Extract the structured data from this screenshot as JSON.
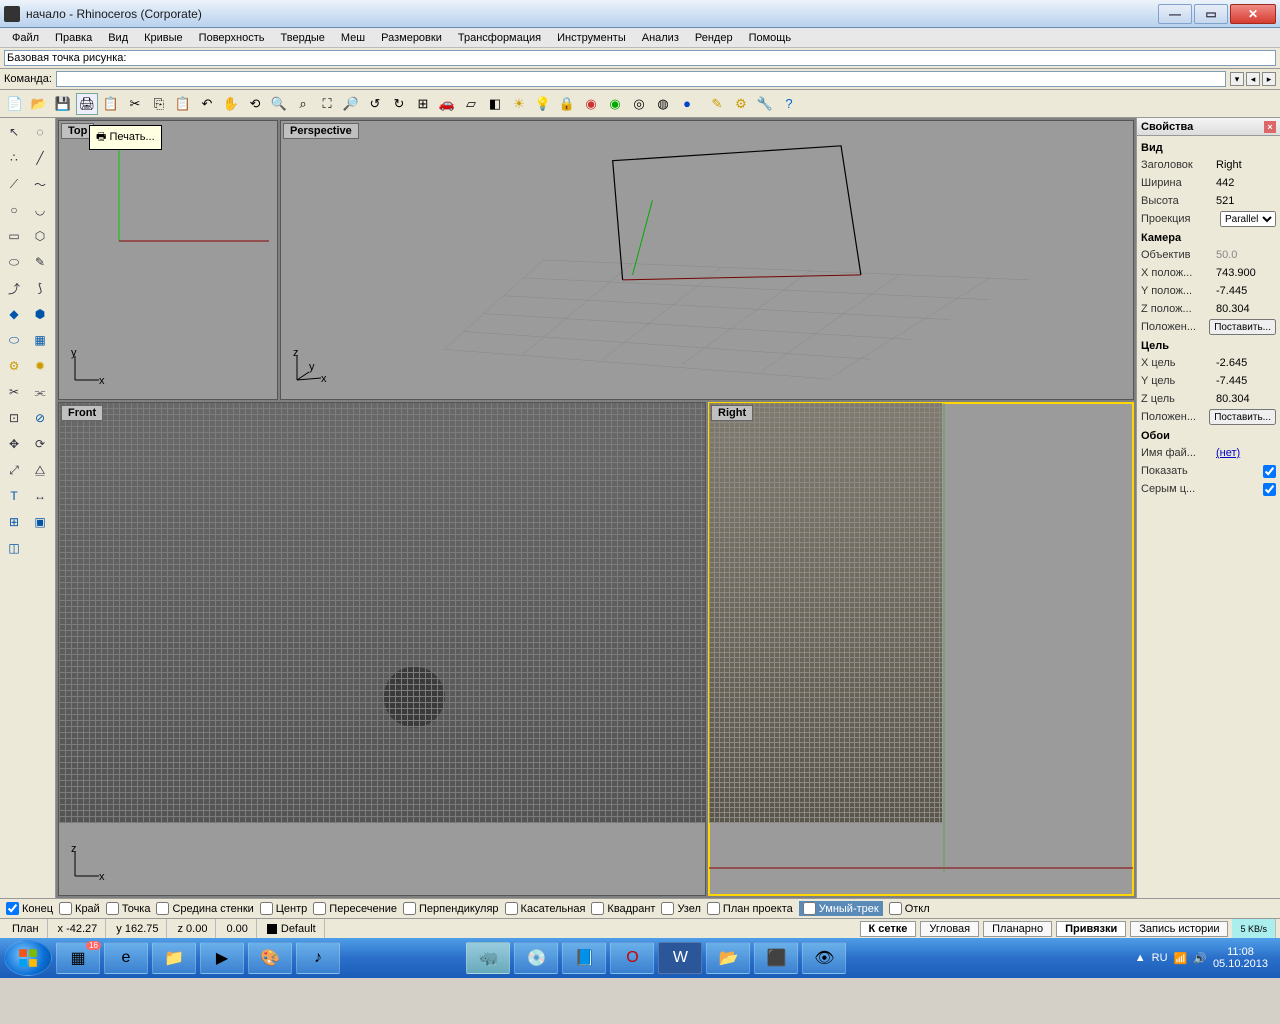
{
  "window": {
    "title": "начало - Rhinoceros (Corporate)"
  },
  "menu": [
    "Файл",
    "Правка",
    "Вид",
    "Кривые",
    "Поверхность",
    "Твердые",
    "Меш",
    "Размеровки",
    "Трансформация",
    "Инструменты",
    "Анализ",
    "Рендер",
    "Помощь"
  ],
  "command_history": "Базовая точка рисунка:",
  "command_label": "Команда:",
  "command_value": "",
  "tooltip": "🖶 Печать...",
  "viewports": {
    "top": "Top",
    "perspective": "Perspective",
    "front": "Front",
    "right": "Right"
  },
  "properties": {
    "title": "Свойства",
    "sections": {
      "view": {
        "label": "Вид",
        "rows": [
          {
            "k": "Заголовок",
            "v": "Right"
          },
          {
            "k": "Ширина",
            "v": "442"
          },
          {
            "k": "Высота",
            "v": "521"
          },
          {
            "k": "Проекция",
            "v": "Parallel",
            "type": "select"
          }
        ]
      },
      "camera": {
        "label": "Камера",
        "rows": [
          {
            "k": "Объектив",
            "v": "50.0",
            "dim": true
          },
          {
            "k": "X полож...",
            "v": "743.900"
          },
          {
            "k": "Y полож...",
            "v": "-7.445"
          },
          {
            "k": "Z полож...",
            "v": "80.304"
          },
          {
            "k": "Положен...",
            "v": "Поставить...",
            "type": "button"
          }
        ]
      },
      "target": {
        "label": "Цель",
        "rows": [
          {
            "k": "X цель",
            "v": "-2.645"
          },
          {
            "k": "Y цель",
            "v": "-7.445"
          },
          {
            "k": "Z цель",
            "v": "80.304"
          },
          {
            "k": "Положен...",
            "v": "Поставить...",
            "type": "button"
          }
        ]
      },
      "wallpaper": {
        "label": "Обои",
        "rows": [
          {
            "k": "Имя фай...",
            "v": "(нет)",
            "type": "link"
          },
          {
            "k": "Показать",
            "v": "",
            "type": "checkbox",
            "checked": true
          },
          {
            "k": "Серым ц...",
            "v": "",
            "type": "checkbox",
            "checked": true
          }
        ]
      }
    }
  },
  "osnap": [
    {
      "label": "Конец",
      "checked": true
    },
    {
      "label": "Край",
      "checked": false
    },
    {
      "label": "Точка",
      "checked": false
    },
    {
      "label": "Средина стенки",
      "checked": false
    },
    {
      "label": "Центр",
      "checked": false
    },
    {
      "label": "Пересечение",
      "checked": false
    },
    {
      "label": "Перпендикуляр",
      "checked": false
    },
    {
      "label": "Касательная",
      "checked": false
    },
    {
      "label": "Квадрант",
      "checked": false
    },
    {
      "label": "Узел",
      "checked": false
    },
    {
      "label": "План проекта",
      "checked": false
    },
    {
      "label": "Умный-трек",
      "checked": false,
      "highlight": true
    },
    {
      "label": "Откл",
      "checked": false
    }
  ],
  "status": {
    "plane": "План",
    "x": "x -42.27",
    "y": "y 162.75",
    "z": "z 0.00",
    "extra": "0.00",
    "layer": "Default",
    "buttons": [
      {
        "label": "К сетке",
        "active": true
      },
      {
        "label": "Угловая",
        "active": false
      },
      {
        "label": "Планарно",
        "active": false
      },
      {
        "label": "Привязки",
        "active": true
      },
      {
        "label": "Запись истории",
        "active": false
      }
    ],
    "net": "5 KB/s"
  },
  "taskbar": {
    "lang": "RU",
    "time": "11:08",
    "date": "05.10.2013",
    "badge": "16"
  }
}
